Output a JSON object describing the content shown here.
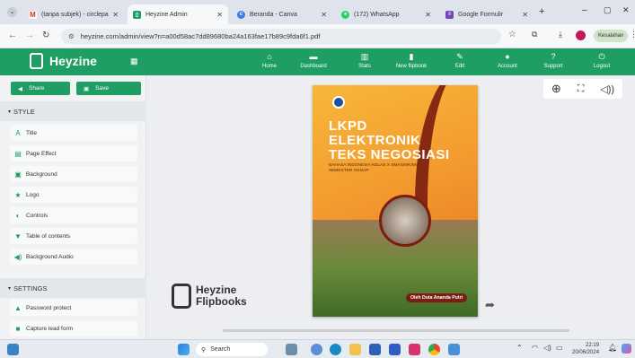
{
  "browser": {
    "tabs": [
      {
        "label": "(tanpa subjek) - circlepa",
        "icon": "gmail-icon",
        "color": "#d93025",
        "active": false
      },
      {
        "label": "Heyzine Admin",
        "icon": "heyzine-icon",
        "color": "#1e9e62",
        "active": true
      },
      {
        "label": "Beranda - Canva",
        "icon": "canva-icon",
        "color": "#3b7bea",
        "active": false
      },
      {
        "label": "(172) WhatsApp",
        "icon": "whatsapp-icon",
        "color": "#25d366",
        "active": false
      },
      {
        "label": "Google Formulir",
        "icon": "forms-icon",
        "color": "#7248b9",
        "active": false
      }
    ],
    "url": "heyzine.com/admin/view?n=a00d58ac7dd89680ba24a163fae17b89c9fda6f1.pdf",
    "profile_label": "Kesalahan"
  },
  "app": {
    "logo_text": "Heyzine",
    "nav": [
      {
        "label": "Home",
        "icon": "home-icon",
        "glyph": "⌂"
      },
      {
        "label": "Dashboard",
        "icon": "dashboard-icon",
        "glyph": "▬"
      },
      {
        "label": "Stats",
        "icon": "stats-icon",
        "glyph": "▥"
      },
      {
        "label": "New flipbook",
        "icon": "new-file-icon",
        "glyph": "▮"
      },
      {
        "label": "Edit",
        "icon": "pencil-icon",
        "glyph": "✎"
      },
      {
        "label": "Account",
        "icon": "user-icon",
        "glyph": "●"
      },
      {
        "label": "Support",
        "icon": "question-icon",
        "glyph": "?"
      },
      {
        "label": "Logout",
        "icon": "power-icon",
        "glyph": "⏻"
      }
    ]
  },
  "sidebar": {
    "share_label": "Share",
    "save_label": "Save",
    "style_header": "STYLE",
    "style_items": [
      {
        "label": "Title",
        "icon": "title-icon",
        "glyph": "A"
      },
      {
        "label": "Page Effect",
        "icon": "page-effect-icon",
        "glyph": "▤"
      },
      {
        "label": "Background",
        "icon": "image-icon",
        "glyph": "▣"
      },
      {
        "label": "Logo",
        "icon": "star-icon",
        "glyph": "★"
      },
      {
        "label": "Controls",
        "icon": "toggle-icon",
        "glyph": "◐"
      },
      {
        "label": "Table of contents",
        "icon": "bookmark-icon",
        "glyph": "▼"
      },
      {
        "label": "Background Audio",
        "icon": "audio-icon",
        "glyph": "◀)"
      }
    ],
    "settings_header": "SETTINGS",
    "settings_items": [
      {
        "label": "Password protect",
        "icon": "lock-icon",
        "glyph": "▲"
      },
      {
        "label": "Capture lead form",
        "icon": "form-icon",
        "glyph": "■"
      }
    ]
  },
  "viewer": {
    "watermark_line1": "Heyzine",
    "watermark_line2": "Flipbooks",
    "book": {
      "title_line1": "LKPD",
      "title_line2": "ELEKTRONIK",
      "title_line3": "TEKS NEGOSIASI",
      "subtitle_line1": "BAHASA INDONESIA KELAS X SMA/SMK/MA",
      "subtitle_line2": "SEMESTER GENAP",
      "author": "Oleh Duta Ananda Putri"
    }
  },
  "taskbar": {
    "search_placeholder": "Search",
    "time": "22:19",
    "date": "20/06/2024"
  }
}
